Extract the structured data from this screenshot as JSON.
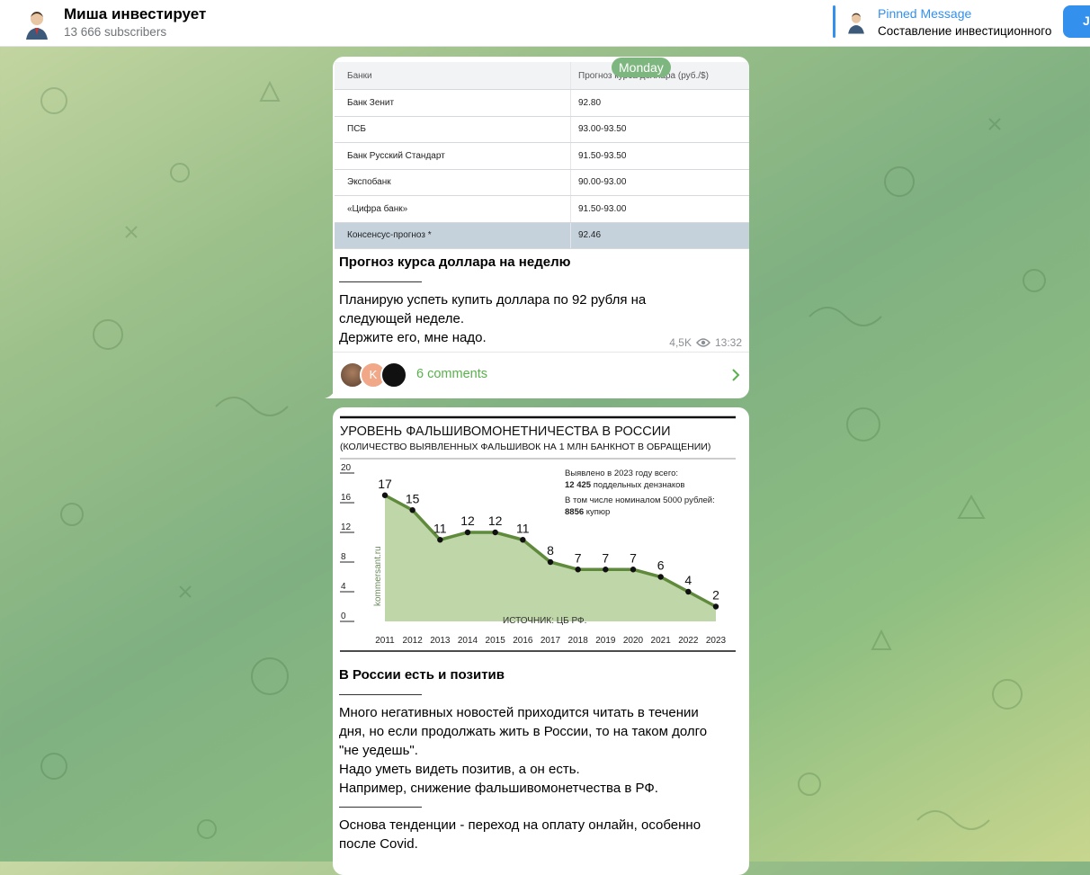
{
  "header": {
    "channel_title": "Миша инвестирует",
    "subscribers": "13 666 subscribers",
    "pinned_label": "Pinned Message",
    "pinned_text": "Составление инвестиционного",
    "join_label": "J"
  },
  "day_label": "Monday",
  "post1": {
    "table": {
      "headers": [
        "Банки",
        "Прогноз курса доллара (руб./$)"
      ],
      "rows": [
        [
          "Банк Зенит",
          "92.80"
        ],
        [
          "ПСБ",
          "93.00-93.50"
        ],
        [
          "Банк Русский Стандарт",
          "91.50-93.50"
        ],
        [
          "Экспобанк",
          "90.00-93.00"
        ],
        [
          "«Цифра банк»",
          "91.50-93.00"
        ],
        [
          "Консенсус-прогноз *",
          "92.46"
        ]
      ]
    },
    "title": "Прогноз курса доллара на неделю",
    "body": [
      "Планирую успеть купить доллара по 92 рубля на",
      "следующей неделе.",
      "Держите его, мне надо."
    ],
    "views": "4,5K",
    "time": "13:32",
    "comment_avatar_letter": "K",
    "comments": "6 comments"
  },
  "post2": {
    "title": "В России есть и позитив",
    "body": [
      "Много негативных новостей приходится читать в течении",
      "дня, но если продолжать жить в России, то на таком долго",
      "\"не уедешь\".",
      "Надо уметь видеть позитив, а он есть.",
      "Например, снижение фальшивомонетчества в РФ."
    ],
    "body2": [
      "Основа тенденции - переход на оплату онлайн, особенно",
      "после Covid."
    ]
  },
  "chart_data": {
    "type": "area",
    "title": "УРОВЕНЬ ФАЛЬШИВОМОНЕТНИЧЕСТВА В РОССИИ",
    "subtitle": "(КОЛИЧЕСТВО ВЫЯВЛЕННЫХ ФАЛЬШИВОК НА 1 МЛН БАНКНОТ В ОБРАЩЕНИИ)",
    "x": [
      "2011",
      "2012",
      "2013",
      "2014",
      "2015",
      "2016",
      "2017",
      "2018",
      "2019",
      "2020",
      "2021",
      "2022",
      "2023"
    ],
    "values": [
      17,
      15,
      11,
      12,
      12,
      11,
      8,
      7,
      7,
      7,
      6,
      4,
      2
    ],
    "yticks": [
      0,
      4,
      8,
      12,
      16,
      20
    ],
    "ylim": [
      0,
      20
    ],
    "watermark": "kommersant.ru",
    "source": "ИСТОЧНИК: ЦБ РФ.",
    "annotation": {
      "line1": "Выявлено в 2023 году всего:",
      "line2_bold": "12 425",
      "line2_rest": " поддельных дензнаков",
      "line3": "В том числе номиналом 5000 рублей:",
      "line4_bold": "8856",
      "line4_rest": " купюр"
    },
    "grid": false,
    "colors": {
      "line": "#5f8a3c",
      "fill": "#bfd6a8",
      "point": "#111111"
    }
  }
}
